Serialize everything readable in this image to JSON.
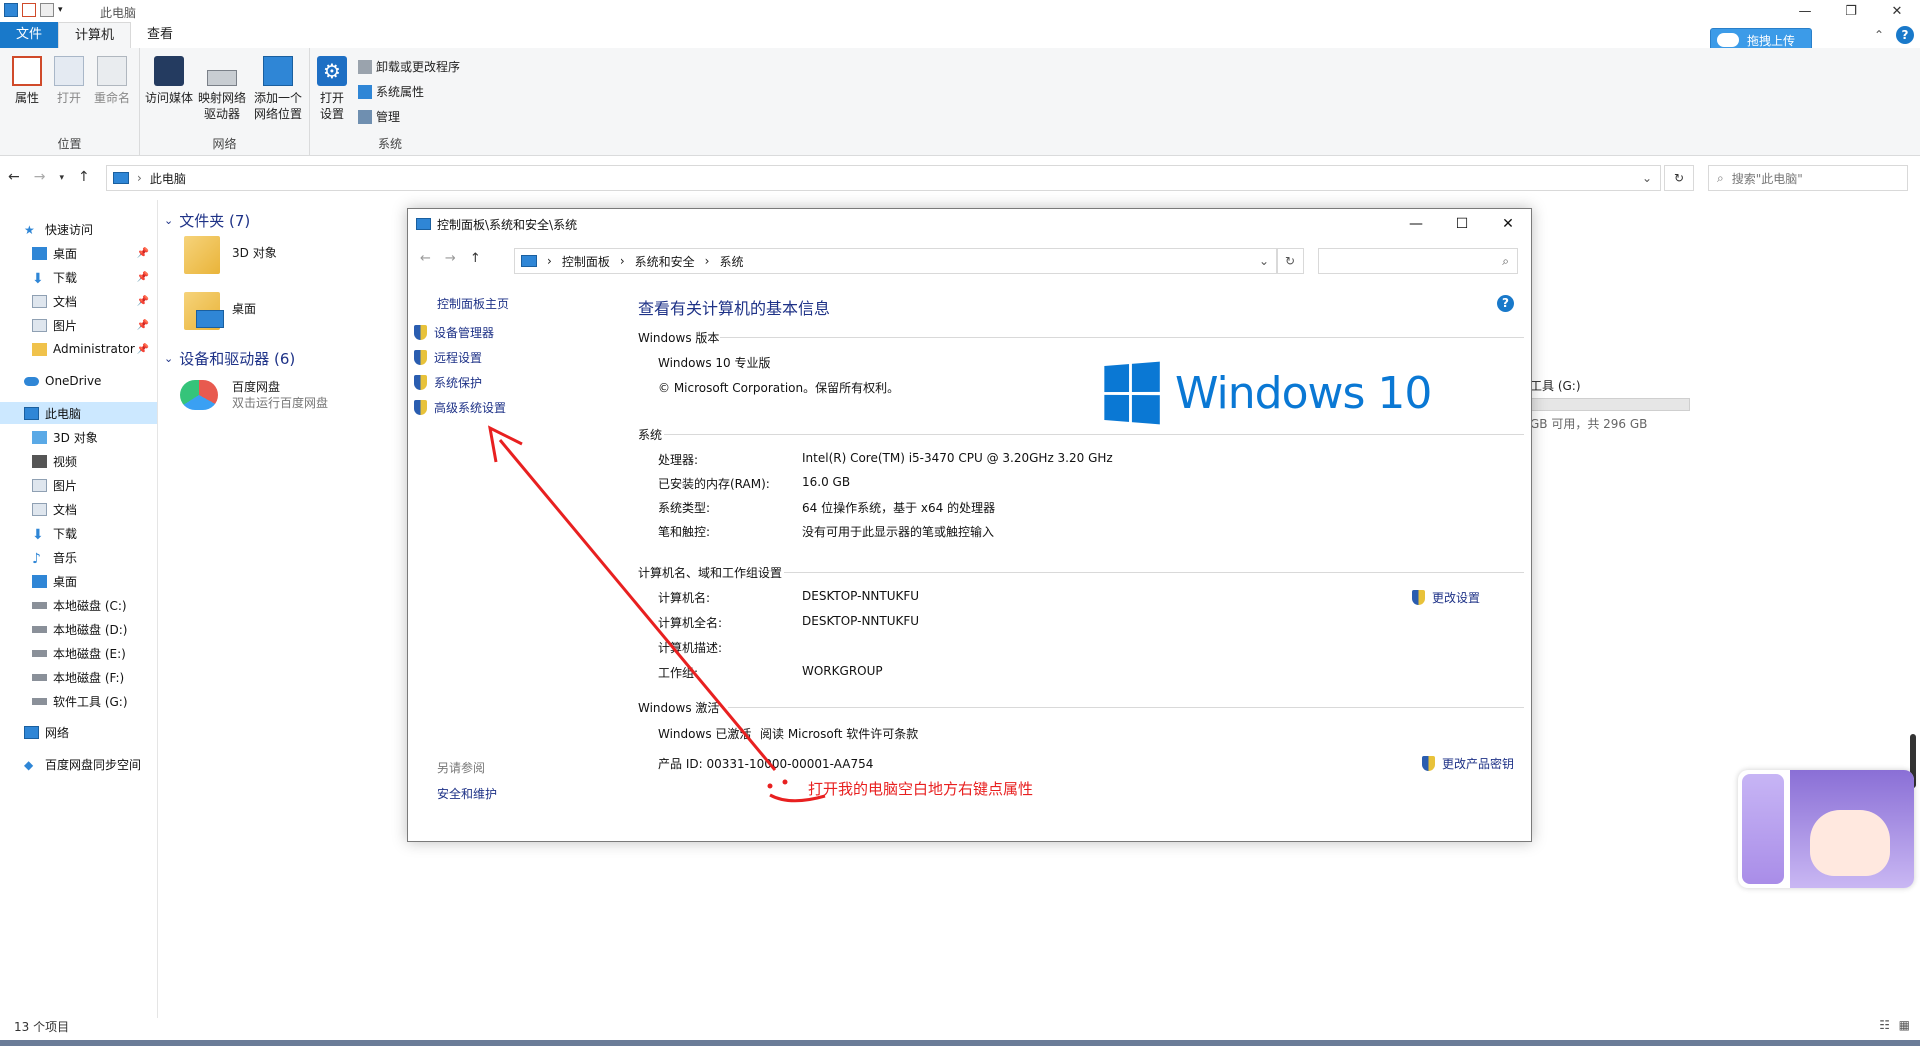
{
  "explorer": {
    "title": "此电脑",
    "tabs": [
      "文件",
      "计算机",
      "查看"
    ],
    "upload_btn": "拖拽上传",
    "ribbon": {
      "location": {
        "label": "位置",
        "buttons": [
          "属性",
          "打开",
          "重命名"
        ]
      },
      "network": {
        "label": "网络",
        "buttons": [
          "访问媒体",
          "映射网络驱动器",
          "添加一个网络位置"
        ]
      },
      "system": {
        "label": "系统",
        "big_button": "打开设置",
        "small_buttons": [
          "卸载或更改程序",
          "系统属性",
          "管理"
        ]
      }
    },
    "address": "此电脑",
    "search_placeholder": "搜索\"此电脑\"",
    "nav": {
      "quick_access": "快速访问",
      "quick_items": [
        "桌面",
        "下载",
        "文档",
        "图片",
        "Administrator"
      ],
      "onedrive": "OneDrive",
      "this_pc": "此电脑",
      "pc_items": [
        "3D 对象",
        "视频",
        "图片",
        "文档",
        "下载",
        "音乐",
        "桌面",
        "本地磁盘 (C:)",
        "本地磁盘 (D:)",
        "本地磁盘 (E:)",
        "本地磁盘 (F:)",
        "软件工具 (G:)"
      ],
      "network": "网络",
      "baidu_sync": "百度网盘同步空间"
    },
    "folders_header": "文件夹 (7)",
    "folders": [
      "3D 对象",
      "桌面"
    ],
    "devices_header": "设备和驱动器 (6)",
    "baidu": {
      "name": "百度网盘",
      "sub": "双击运行百度网盘"
    },
    "drive_g": {
      "name": "工具 (G:)",
      "sub": "GB 可用，共 296 GB"
    },
    "status": "13 个项目"
  },
  "sysinfo": {
    "title": "控制面板\\系统和安全\\系统",
    "breadcrumb": [
      "控制面板",
      "系统和安全",
      "系统"
    ],
    "left_home": "控制面板主页",
    "left_links": [
      "设备管理器",
      "远程设置",
      "系统保护",
      "高级系统设置"
    ],
    "see_also_title": "另请参阅",
    "see_also": "安全和维护",
    "heading": "查看有关计算机的基本信息",
    "edition_section": "Windows 版本",
    "edition": "Windows 10 专业版",
    "copyright": "© Microsoft Corporation。保留所有权利。",
    "logo_text": "Windows 10",
    "system_section": "系统",
    "system_rows": [
      {
        "k": "处理器:",
        "v": "Intel(R) Core(TM) i5-3470 CPU @ 3.20GHz   3.20 GHz"
      },
      {
        "k": "已安装的内存(RAM):",
        "v": "16.0 GB"
      },
      {
        "k": "系统类型:",
        "v": "64 位操作系统，基于 x64 的处理器"
      },
      {
        "k": "笔和触控:",
        "v": "没有可用于此显示器的笔或触控输入"
      }
    ],
    "computer_section": "计算机名、域和工作组设置",
    "computer_rows": [
      {
        "k": "计算机名:",
        "v": "DESKTOP-NNTUKFU"
      },
      {
        "k": "计算机全名:",
        "v": "DESKTOP-NNTUKFU"
      },
      {
        "k": "计算机描述:",
        "v": ""
      },
      {
        "k": "工作组:",
        "v": "WORKGROUP"
      }
    ],
    "change_settings": "更改设置",
    "activation_section": "Windows 激活",
    "activated": "Windows 已激活",
    "license_link": "阅读 Microsoft 软件许可条款",
    "product_id": "产品 ID: 00331-10000-00001-AA754",
    "change_key": "更改产品密钥"
  },
  "annotation": "打开我的电脑空白地方右键点属性",
  "colors": {
    "accent": "#1979ca",
    "link": "#1e3287",
    "annotation": "#e82020"
  }
}
